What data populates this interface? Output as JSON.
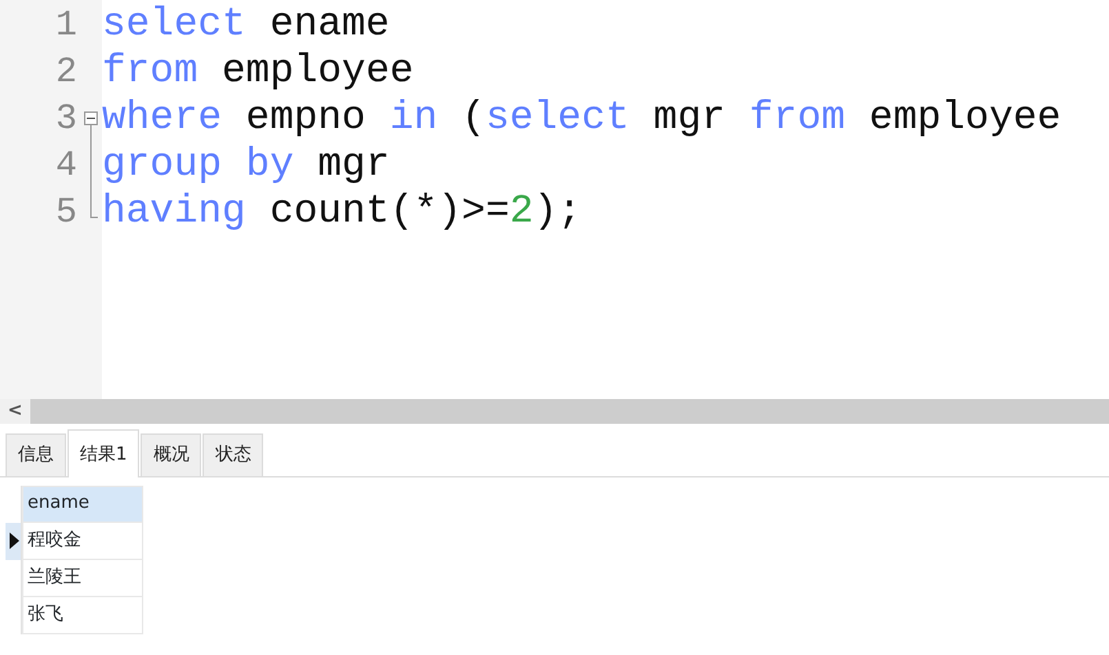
{
  "editor": {
    "lines": [
      {
        "number": "1",
        "kind": "plain",
        "tokens": [
          {
            "text": "select",
            "kind": "keyword"
          },
          {
            "text": " ename",
            "kind": "plain"
          }
        ]
      },
      {
        "number": "2",
        "kind": "plain",
        "tokens": [
          {
            "text": "from",
            "kind": "keyword"
          },
          {
            "text": " employee",
            "kind": "plain"
          }
        ]
      },
      {
        "number": "3",
        "kind": "foldstart",
        "tokens": [
          {
            "text": "where",
            "kind": "keyword"
          },
          {
            "text": " empno ",
            "kind": "plain"
          },
          {
            "text": "in",
            "kind": "keyword"
          },
          {
            "text": " (",
            "kind": "plain"
          },
          {
            "text": "select",
            "kind": "keyword"
          },
          {
            "text": " mgr ",
            "kind": "plain"
          },
          {
            "text": "from",
            "kind": "keyword"
          },
          {
            "text": " employee",
            "kind": "plain"
          }
        ]
      },
      {
        "number": "4",
        "kind": "foldinside",
        "tokens": [
          {
            "text": "group ",
            "kind": "keyword"
          },
          {
            "text": "by",
            "kind": "keyword"
          },
          {
            "text": " mgr",
            "kind": "plain"
          }
        ]
      },
      {
        "number": "5",
        "kind": "foldend",
        "tokens": [
          {
            "text": "having",
            "kind": "keyword"
          },
          {
            "text": " count(*)>=",
            "kind": "plain"
          },
          {
            "text": "2",
            "kind": "number"
          },
          {
            "text": ");",
            "kind": "plain"
          }
        ]
      }
    ]
  },
  "scroll_left": "<",
  "tabs": [
    {
      "label": "信息",
      "selected": false
    },
    {
      "label": "结果1",
      "selected": true
    },
    {
      "label": "概况",
      "selected": false
    },
    {
      "label": "状态",
      "selected": false
    }
  ],
  "grid": {
    "columns": [
      "ename"
    ],
    "rows": [
      {
        "cells": [
          "程咬金"
        ],
        "selected": true
      },
      {
        "cells": [
          "兰陵王"
        ],
        "selected": false
      },
      {
        "cells": [
          "张飞"
        ],
        "selected": false
      }
    ]
  }
}
